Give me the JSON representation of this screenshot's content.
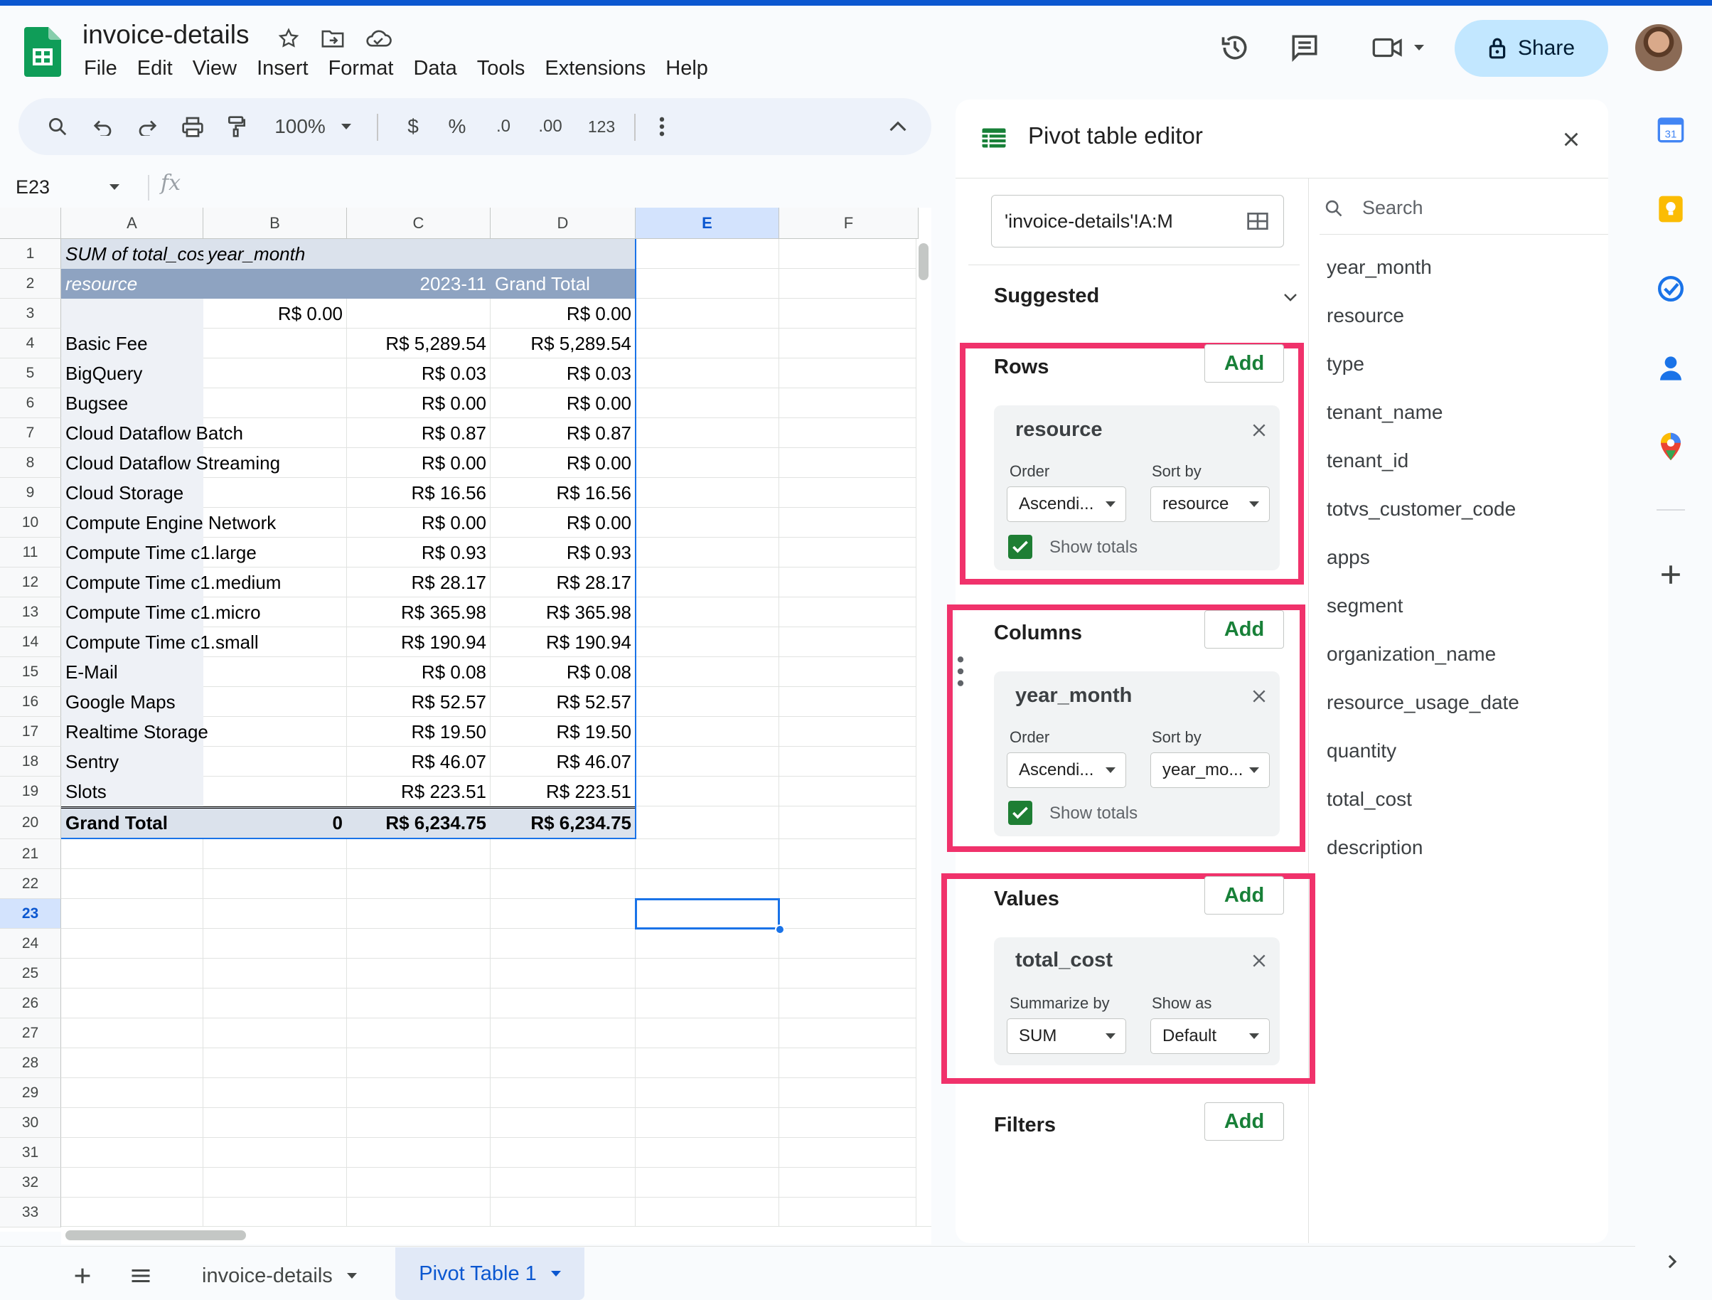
{
  "doc": {
    "title": "invoice-details",
    "menu": [
      "File",
      "Edit",
      "View",
      "Insert",
      "Format",
      "Data",
      "Tools",
      "Extensions",
      "Help"
    ],
    "share_label": "Share"
  },
  "toolbar": {
    "zoom": "100%",
    "currency": "$",
    "percent": "%",
    "dec_decrease": ".0",
    "dec_increase": ".00",
    "format_123": "123"
  },
  "formula_bar": {
    "cell_ref": "E23",
    "fx": "fx"
  },
  "grid": {
    "columns": [
      "A",
      "B",
      "C",
      "D",
      "E",
      "F"
    ],
    "selected_column": "E",
    "selected_row": "23",
    "row_numbers": [
      "1",
      "2",
      "3",
      "4",
      "5",
      "6",
      "7",
      "8",
      "9",
      "10",
      "11",
      "12",
      "13",
      "14",
      "15",
      "16",
      "17",
      "18",
      "19",
      "20",
      "21",
      "22",
      "23",
      "24",
      "25",
      "26",
      "27",
      "28",
      "29",
      "30",
      "31",
      "32",
      "33"
    ],
    "pivot_header": {
      "a1": "SUM of total_cost",
      "b1": "year_month",
      "a2": "resource",
      "c2": "2023-11",
      "d2": "Grand Total"
    },
    "rows": [
      {
        "a": "",
        "b": "R$ 0.00",
        "c": "",
        "d": "R$ 0.00"
      },
      {
        "a": "Basic Fee",
        "b": "",
        "c": "R$ 5,289.54",
        "d": "R$ 5,289.54"
      },
      {
        "a": "BigQuery",
        "b": "",
        "c": "R$ 0.03",
        "d": "R$ 0.03"
      },
      {
        "a": "Bugsee",
        "b": "",
        "c": "R$ 0.00",
        "d": "R$ 0.00"
      },
      {
        "a": "Cloud Dataflow Batch",
        "b": "",
        "c": "R$ 0.87",
        "d": "R$ 0.87"
      },
      {
        "a": "Cloud Dataflow Streaming",
        "b": "",
        "c": "R$ 0.00",
        "d": "R$ 0.00"
      },
      {
        "a": "Cloud Storage",
        "b": "",
        "c": "R$ 16.56",
        "d": "R$ 16.56"
      },
      {
        "a": "Compute Engine Network",
        "b": "",
        "c": "R$ 0.00",
        "d": "R$ 0.00"
      },
      {
        "a": "Compute Time c1.large",
        "b": "",
        "c": "R$ 0.93",
        "d": "R$ 0.93"
      },
      {
        "a": "Compute Time c1.medium",
        "b": "",
        "c": "R$ 28.17",
        "d": "R$ 28.17"
      },
      {
        "a": "Compute Time c1.micro",
        "b": "",
        "c": "R$ 365.98",
        "d": "R$ 365.98"
      },
      {
        "a": "Compute Time c1.small",
        "b": "",
        "c": "R$ 190.94",
        "d": "R$ 190.94"
      },
      {
        "a": "E-Mail",
        "b": "",
        "c": "R$ 0.08",
        "d": "R$ 0.08"
      },
      {
        "a": "Google Maps",
        "b": "",
        "c": "R$ 52.57",
        "d": "R$ 52.57"
      },
      {
        "a": "Realtime Storage",
        "b": "",
        "c": "R$ 19.50",
        "d": "R$ 19.50"
      },
      {
        "a": "Sentry",
        "b": "",
        "c": "R$ 46.07",
        "d": "R$ 46.07"
      },
      {
        "a": "Slots",
        "b": "",
        "c": "R$ 223.51",
        "d": "R$ 223.51"
      }
    ],
    "grand_total": {
      "a": "Grand Total",
      "b": "0",
      "c": "R$ 6,234.75",
      "d": "R$ 6,234.75"
    }
  },
  "sheet_tabs": {
    "tabs": [
      "invoice-details",
      "Pivot Table 1"
    ],
    "active": "Pivot Table 1"
  },
  "pivot_editor": {
    "title": "Pivot table editor",
    "range": "'invoice-details'!A:M",
    "suggested_label": "Suggested",
    "add_label": "Add",
    "rows": {
      "label": "Rows",
      "field": "resource",
      "order_label": "Order",
      "order_value": "Ascendi...",
      "sort_label": "Sort by",
      "sort_value": "resource",
      "show_totals_label": "Show totals"
    },
    "columns": {
      "label": "Columns",
      "field": "year_month",
      "order_label": "Order",
      "order_value": "Ascendi...",
      "sort_label": "Sort by",
      "sort_value": "year_mo...",
      "show_totals_label": "Show totals"
    },
    "values": {
      "label": "Values",
      "field": "total_cost",
      "summarize_label": "Summarize by",
      "summarize_value": "SUM",
      "show_as_label": "Show as",
      "show_as_value": "Default"
    },
    "filters": {
      "label": "Filters"
    },
    "search_placeholder": "Search",
    "fields": [
      "year_month",
      "resource",
      "type",
      "tenant_name",
      "tenant_id",
      "totvs_customer_code",
      "apps",
      "segment",
      "organization_name",
      "resource_usage_date",
      "quantity",
      "total_cost",
      "description"
    ]
  },
  "colors": {
    "accent": "#0b57d0",
    "highlight_box": "#f0326b",
    "add_green": "#188038",
    "pivot_header_bg": "#8ea3c1"
  }
}
